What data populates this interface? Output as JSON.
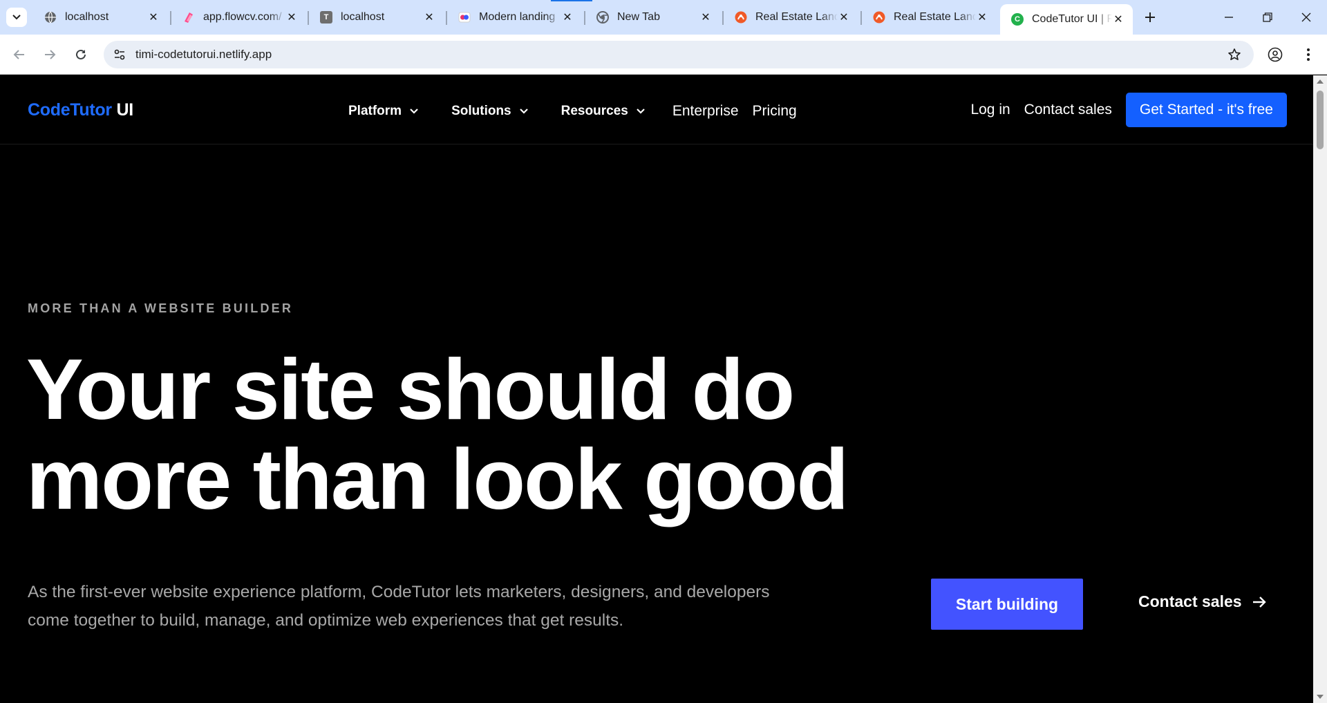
{
  "browser": {
    "tabs": [
      {
        "title": "localhost",
        "icon": "globe-icon",
        "color": "#5f6368"
      },
      {
        "title": "app.flowcv.com/",
        "icon": "flowcv-icon",
        "color": "#ff4d8d"
      },
      {
        "title": "localhost",
        "icon": "t-letter-icon",
        "color": "#6e6e6e",
        "letter": "T"
      },
      {
        "title": "Modern landing",
        "icon": "landing-icon",
        "color": "#e8336b"
      },
      {
        "title": "New Tab",
        "icon": "chrome-icon",
        "color": "#5f6368"
      },
      {
        "title": "Real Estate Land",
        "icon": "realestate-icon",
        "color": "#f05a28"
      },
      {
        "title": "Real Estate Land",
        "icon": "realestate-icon",
        "color": "#f05a28"
      },
      {
        "title": "CodeTutor UI | R",
        "icon": "codetutor-favicon-icon",
        "color": "#22b14c",
        "letter": "C",
        "active": true
      }
    ],
    "url": "timi-codetutorui.netlify.app"
  },
  "nav": {
    "logo_brand": "CodeTutor",
    "logo_suffix": "UI",
    "menu": [
      {
        "label": "Platform",
        "dropdown": true
      },
      {
        "label": "Solutions",
        "dropdown": true
      },
      {
        "label": "Resources",
        "dropdown": true
      }
    ],
    "links": [
      "Enterprise",
      "Pricing"
    ],
    "login": "Log in",
    "contact_sales": "Contact sales",
    "cta": "Get Started - it's free"
  },
  "hero": {
    "eyebrow": "MORE THAN A WEBSITE BUILDER",
    "headline_line1": "Your site should do",
    "headline_line2": "more than look good",
    "lede": "As the first-ever website experience platform, CodeTutor lets marketers, designers, and developers come together to build, manage, and optimize web experiences that get results.",
    "primary_button": "Start building",
    "secondary_button": "Contact sales"
  },
  "colors": {
    "brand_blue": "#1f6cff",
    "cta_blue": "#1460ff",
    "start_button": "#4353ff",
    "page_bg": "#000000"
  }
}
